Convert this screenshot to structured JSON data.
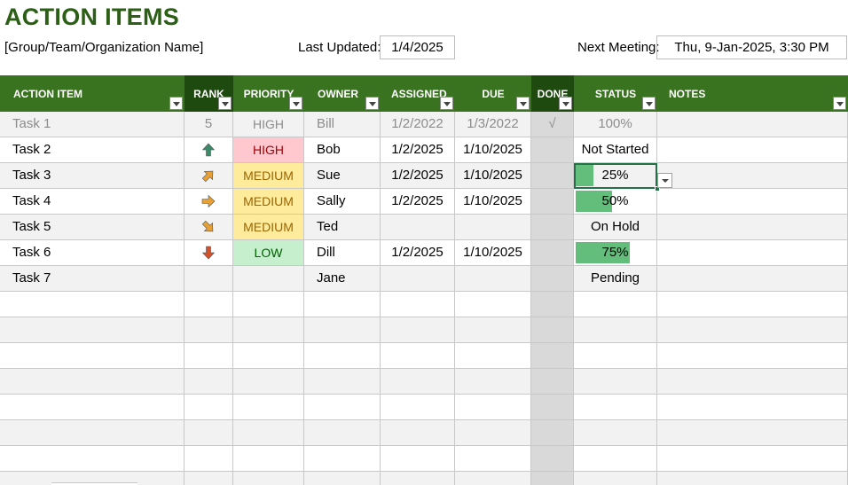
{
  "title": "ACTION ITEMS",
  "group_name": "[Group/Team/Organization Name]",
  "last_updated": {
    "label": "Last Updated:",
    "value": "1/4/2025"
  },
  "next_meeting": {
    "label": "Next Meeting:",
    "value": "Thu, 9-Jan-2025, 3:30 PM"
  },
  "colors": {
    "title": "#2c5f16",
    "header_bg": "#3a7320",
    "header_dark": "#1e4a10",
    "high_bg": "#ffc7ce",
    "medium_bg": "#ffeb9c",
    "low_bg": "#c6efce",
    "status_bar": "#63be7b",
    "done_column": "#d9d9d9"
  },
  "columns": [
    {
      "key": "action_item",
      "label": "ACTION ITEM"
    },
    {
      "key": "rank",
      "label": "RANK"
    },
    {
      "key": "priority",
      "label": "PRIORITY"
    },
    {
      "key": "owner",
      "label": "OWNER"
    },
    {
      "key": "assigned",
      "label": "ASSIGNED"
    },
    {
      "key": "due",
      "label": "DUE"
    },
    {
      "key": "done",
      "label": "DONE"
    },
    {
      "key": "status",
      "label": "STATUS"
    },
    {
      "key": "notes",
      "label": "NOTES"
    }
  ],
  "rows": [
    {
      "action_item": "Task 1",
      "rank": "5",
      "rank_icon": null,
      "priority": "HIGH",
      "priority_level": "none",
      "owner": "Bill",
      "assigned": "1/2/2022",
      "due": "1/3/2022",
      "done": "√",
      "status": "100%",
      "status_progress": null,
      "notes": "",
      "completed": true
    },
    {
      "action_item": "Task 2",
      "rank": "",
      "rank_icon": "arrow-up-icon",
      "priority": "HIGH",
      "priority_level": "high",
      "owner": "Bob",
      "assigned": "1/2/2025",
      "due": "1/10/2025",
      "done": "",
      "status": "Not Started",
      "status_progress": null,
      "notes": "",
      "completed": false
    },
    {
      "action_item": "Task 3",
      "rank": "",
      "rank_icon": "arrow-up-right-icon",
      "priority": "MEDIUM",
      "priority_level": "medium",
      "owner": "Sue",
      "assigned": "1/2/2025",
      "due": "1/10/2025",
      "done": "",
      "status": "25%",
      "status_progress": 0.25,
      "notes": "",
      "completed": false
    },
    {
      "action_item": "Task 4",
      "rank": "",
      "rank_icon": "arrow-right-icon",
      "priority": "MEDIUM",
      "priority_level": "medium",
      "owner": "Sally",
      "assigned": "1/2/2025",
      "due": "1/10/2025",
      "done": "",
      "status": "50%",
      "status_progress": 0.5,
      "notes": "",
      "completed": false
    },
    {
      "action_item": "Task 5",
      "rank": "",
      "rank_icon": "arrow-down-right-icon",
      "priority": "MEDIUM",
      "priority_level": "medium",
      "owner": "Ted",
      "assigned": "",
      "due": "",
      "done": "",
      "status": "On Hold",
      "status_progress": null,
      "notes": "",
      "completed": false
    },
    {
      "action_item": "Task 6",
      "rank": "",
      "rank_icon": "arrow-down-icon",
      "priority": "LOW",
      "priority_level": "low",
      "owner": "Dill",
      "assigned": "1/2/2025",
      "due": "1/10/2025",
      "done": "",
      "status": "75%",
      "status_progress": 0.75,
      "notes": "",
      "completed": false
    },
    {
      "action_item": "Task 7",
      "rank": "",
      "rank_icon": null,
      "priority": "",
      "priority_level": "none",
      "owner": "Jane",
      "assigned": "",
      "due": "",
      "done": "",
      "status": "Pending",
      "status_progress": null,
      "notes": "",
      "completed": false
    }
  ],
  "selected_cell": {
    "row": 2,
    "column": "status"
  }
}
